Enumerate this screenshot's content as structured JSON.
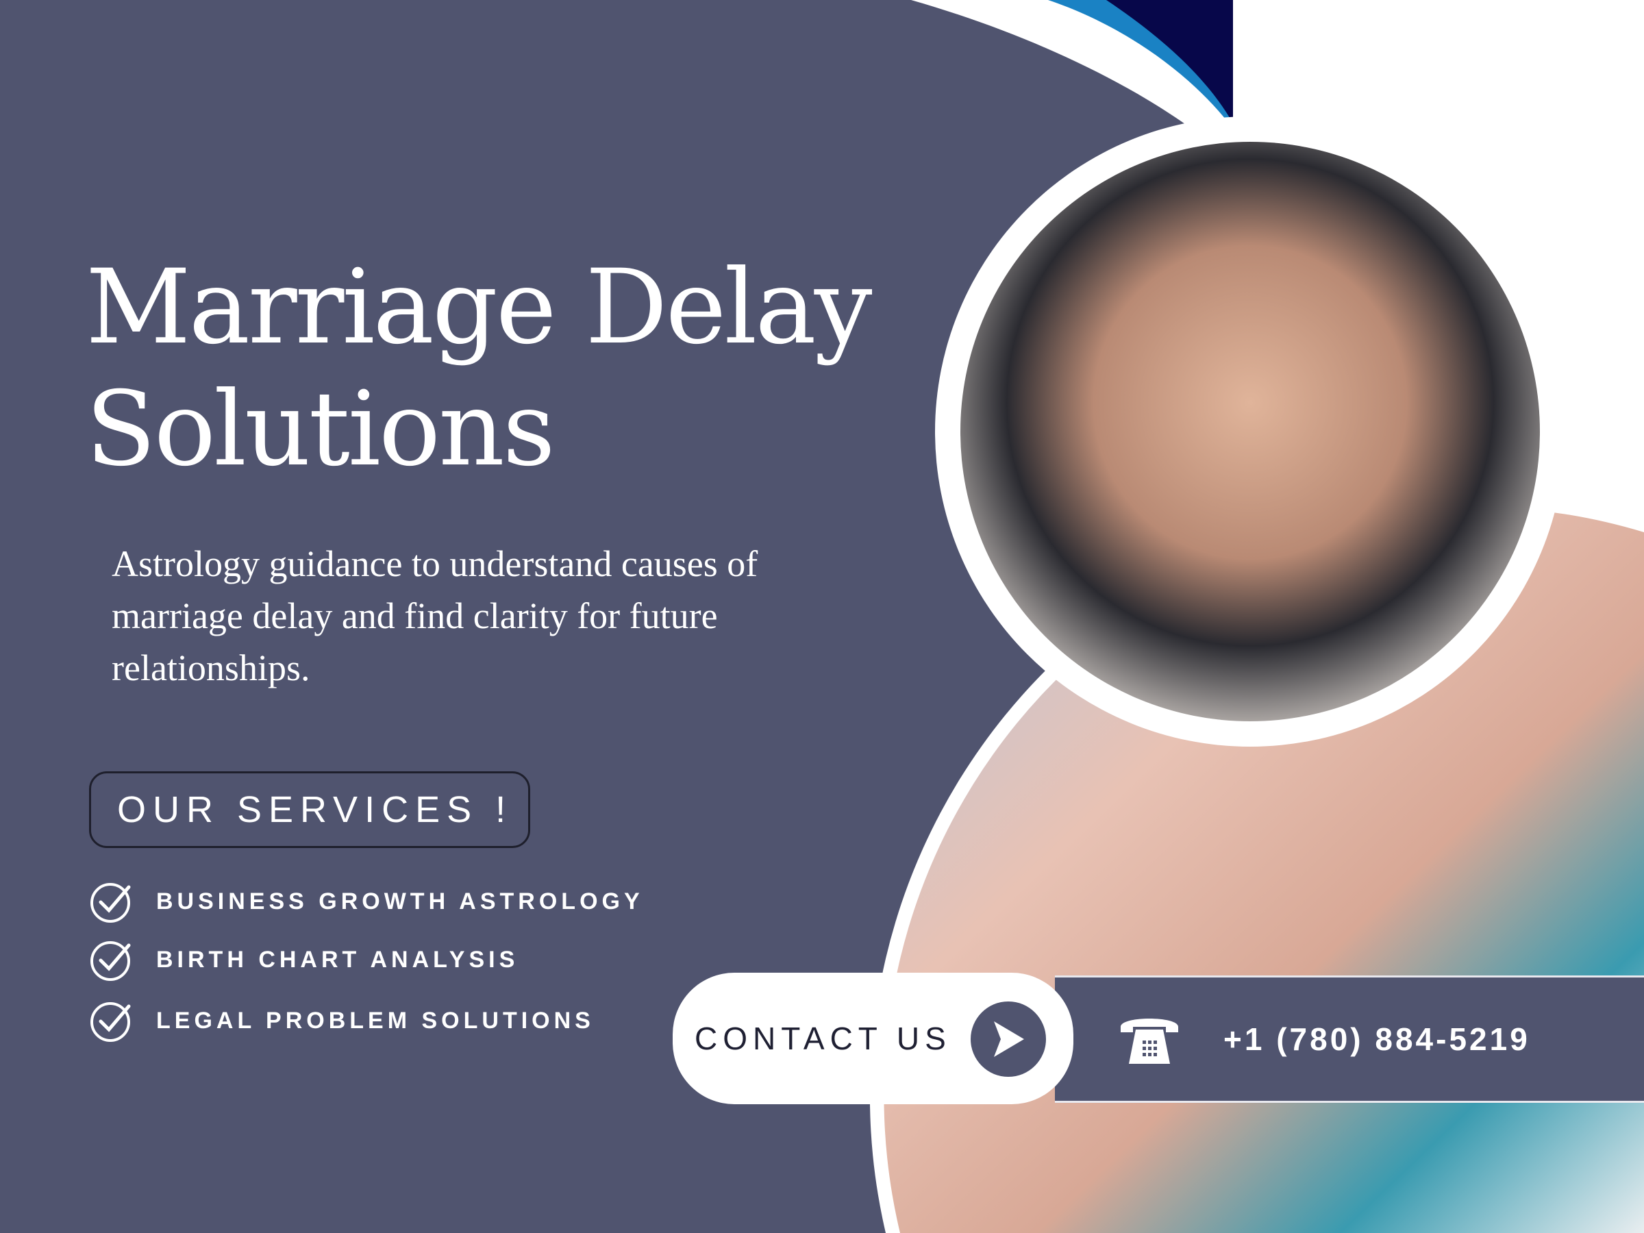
{
  "colors": {
    "background": "#50546f",
    "accent_light_blue": "#1a82c4",
    "accent_navy": "#07074a",
    "white": "#ffffff"
  },
  "title": {
    "line1": "Marriage Delay",
    "line2": "Solutions"
  },
  "description": "Astrology guidance to understand causes of marriage delay and find clarity for future relationships.",
  "services": {
    "button_label": "OUR SERVICES !",
    "items": [
      {
        "label": "BUSINESS GROWTH ASTROLOGY",
        "icon": "check-circle-icon"
      },
      {
        "label": "BIRTH CHART ANALYSIS",
        "icon": "check-circle-icon"
      },
      {
        "label": "LEGAL PROBLEM SOLUTIONS",
        "icon": "check-circle-icon"
      }
    ]
  },
  "contact": {
    "label": "CONTACT US",
    "icon": "play-arrow-icon",
    "phone_icon": "telephone-icon",
    "phone": "+1 (780) 884-5219"
  }
}
